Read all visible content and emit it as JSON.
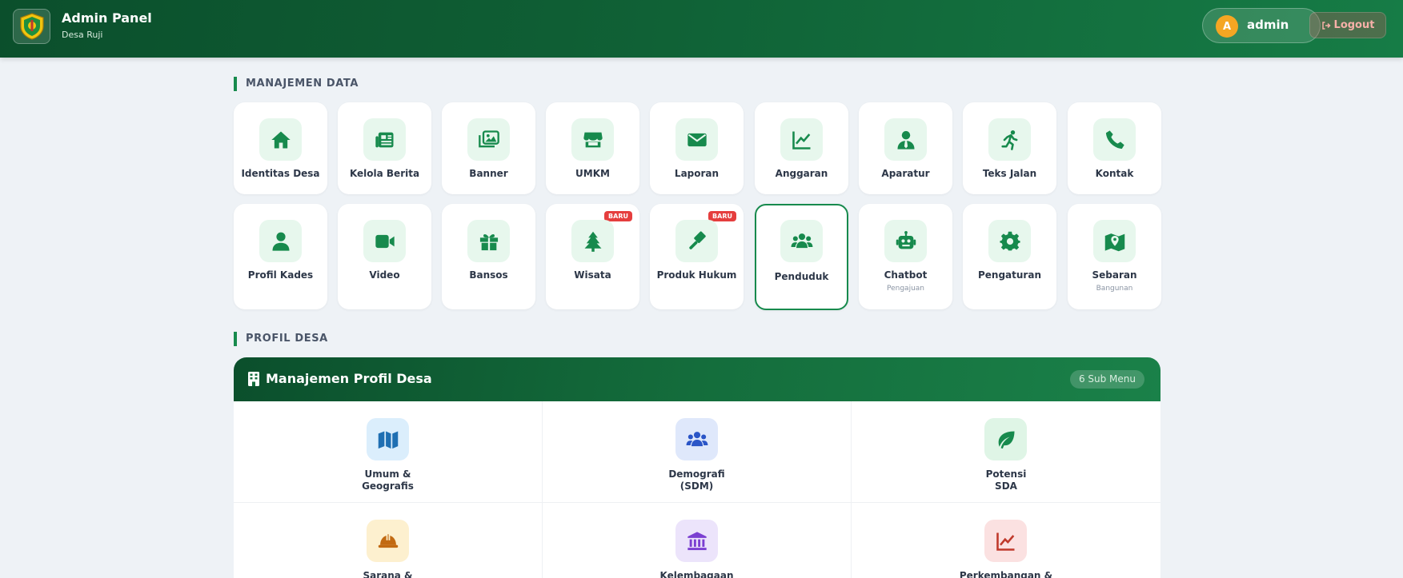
{
  "header": {
    "title": "Admin Panel",
    "subtitle": "Desa Ruji",
    "user_initial": "A",
    "user_name": "admin",
    "logout_label": "Logout"
  },
  "sections": {
    "data_title": "MANAJEMEN DATA",
    "profil_title": "PROFIL DESA"
  },
  "menu": [
    {
      "label": "Identitas Desa",
      "icon": "home-icon"
    },
    {
      "label": "Kelola Berita",
      "icon": "newspaper-icon"
    },
    {
      "label": "Banner",
      "icon": "images-icon"
    },
    {
      "label": "UMKM",
      "icon": "store-icon"
    },
    {
      "label": "Laporan",
      "icon": "envelope-icon"
    },
    {
      "label": "Anggaran",
      "icon": "line-chart-icon"
    },
    {
      "label": "Aparatur",
      "icon": "user-tie-icon"
    },
    {
      "label": "Teks Jalan",
      "icon": "running-icon"
    },
    {
      "label": "Kontak",
      "icon": "phone-icon"
    },
    {
      "label": "Profil Kades",
      "icon": "user-icon"
    },
    {
      "label": "Video",
      "icon": "video-icon"
    },
    {
      "label": "Bansos",
      "icon": "gift-icon"
    },
    {
      "label": "Wisata",
      "icon": "tree-icon",
      "badge": "BARU"
    },
    {
      "label": "Produk Hukum",
      "icon": "gavel-icon",
      "badge": "BARU"
    },
    {
      "label": "Penduduk",
      "icon": "users-icon",
      "active": true
    },
    {
      "label": "Chatbot",
      "sub": "Pengajuan",
      "icon": "robot-icon"
    },
    {
      "label": "Pengaturan",
      "icon": "gear-icon"
    },
    {
      "label": "Sebaran",
      "sub": "Bangunan",
      "icon": "map-marker-icon"
    }
  ],
  "profil": {
    "panel_title": "Manajemen Profil Desa",
    "submenu_count": "6 Sub Menu",
    "items": [
      {
        "line1": "Umum &",
        "line2": "Geografis",
        "icon": "map-icon",
        "bg": "#dbeefc",
        "color": "#1f6fb2"
      },
      {
        "line1": "Demografi",
        "line2": "(SDM)",
        "icon": "users-icon",
        "bg": "#dfe8fb",
        "color": "#2a55c7"
      },
      {
        "line1": "Potensi",
        "line2": "SDA",
        "icon": "leaf-icon",
        "bg": "#dff5e6",
        "color": "#178a4d"
      },
      {
        "line1": "Sarana &",
        "line2": "",
        "icon": "hard-hat-icon",
        "bg": "#fdf0cf",
        "color": "#c26a12"
      },
      {
        "line1": "Kelembagaan",
        "line2": "",
        "icon": "landmark-icon",
        "bg": "#ece4fb",
        "color": "#7b3fd1"
      },
      {
        "line1": "Perkembangan &",
        "line2": "",
        "icon": "chart-line-icon",
        "bg": "#fbe1e1",
        "color": "#c0392b"
      }
    ]
  },
  "colors": {
    "brand": "#178a4d",
    "header_dark": "#0b4f2c",
    "badge": "#e53e3e",
    "avatar": "#f5a623"
  }
}
